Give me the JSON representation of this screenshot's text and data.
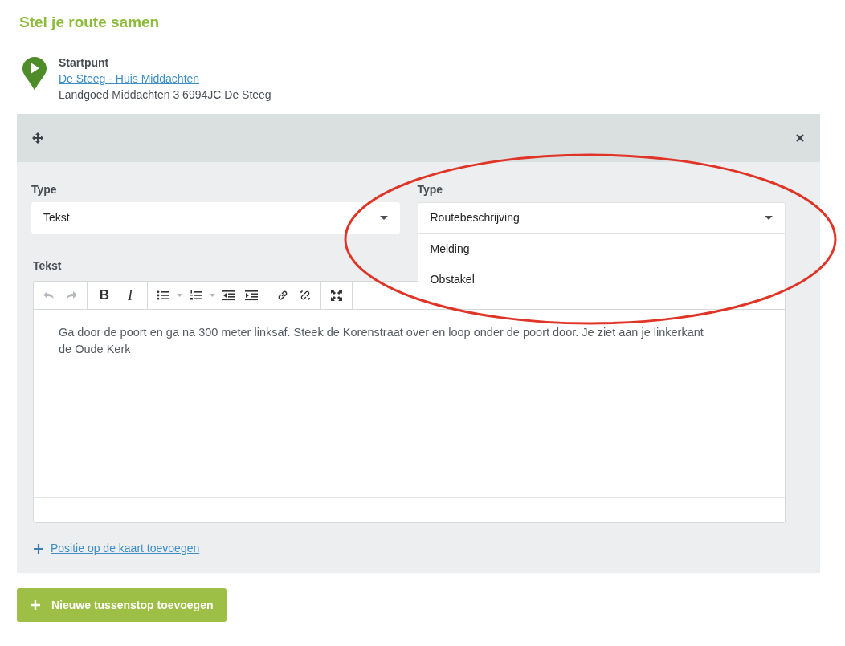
{
  "page_title": "Stel je route samen",
  "start": {
    "label": "Startpunt",
    "name": "De Steeg - Huis Middachten",
    "address": "Landgoed Middachten 3 6994JC De Steeg"
  },
  "stop": {
    "type_select": {
      "label": "Type",
      "value": "Tekst"
    },
    "subtype_select": {
      "label": "Type",
      "value": "Routebeschrijving",
      "expanded": true,
      "options": [
        {
          "label": "Melding",
          "selected": false
        },
        {
          "label": "Obstakel",
          "selected": false
        }
      ]
    },
    "editor": {
      "label": "Tekst",
      "toolbar": {
        "bold": "B",
        "italic": "I",
        "undo_disabled": true,
        "redo_disabled": true
      },
      "content": "Ga door de poort en ga na 300 meter linksaf. Steek de Korenstraat over en loop onder de poort door. Je ziet aan je linkerkant de Oude Kerk"
    },
    "add_position_link": "Positie op de kaart toevoegen"
  },
  "add_stop_button": "Nieuwe tussenstop toevoegen",
  "annotation": {
    "kind": "ellipse"
  }
}
